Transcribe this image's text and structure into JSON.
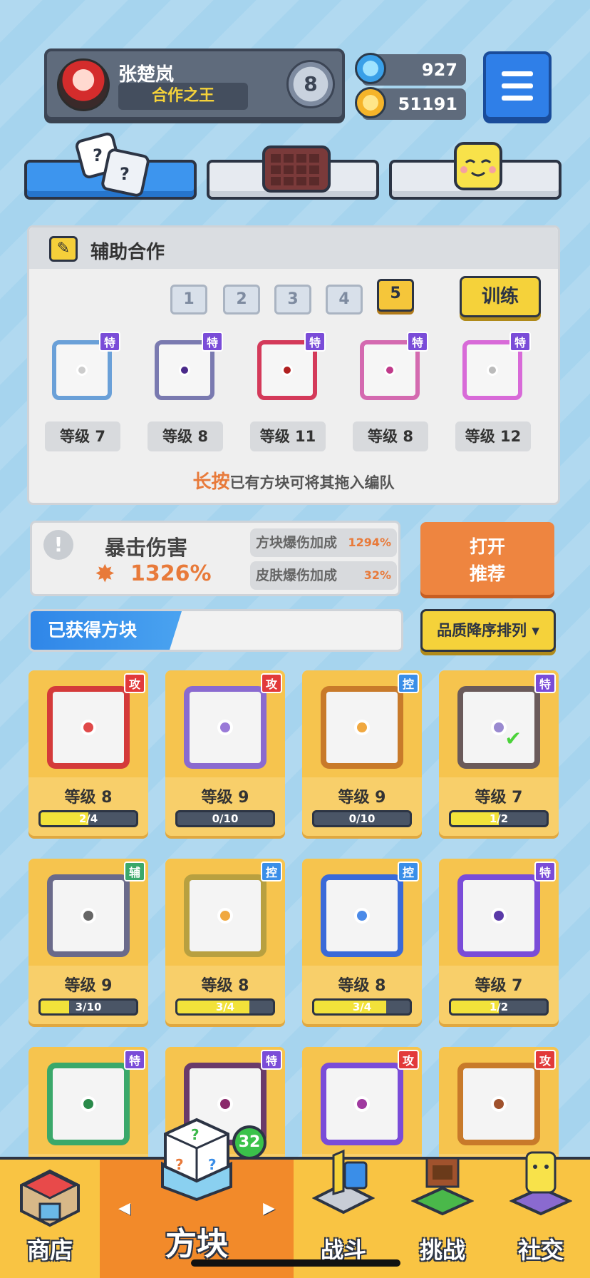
{
  "player": {
    "name": "张楚岚",
    "title": "合作之王",
    "rank": "8"
  },
  "currency": {
    "gems": "927",
    "coins": "51191"
  },
  "tabs": [
    {
      "name": "dice"
    },
    {
      "name": "grid"
    },
    {
      "name": "face"
    }
  ],
  "assist": {
    "title": "辅助合作",
    "pages": [
      "1",
      "2",
      "3",
      "4",
      "5"
    ],
    "active_page": "5",
    "train_label": "训练",
    "slots": [
      {
        "tag": "特",
        "level": "等级 7",
        "color": "#7a4cd8",
        "frame": "#6aa0d8",
        "core": "#cccccc"
      },
      {
        "tag": "特",
        "level": "等级 8",
        "color": "#7a4cd8",
        "frame": "#7a7ab0",
        "core": "#4a2a8a"
      },
      {
        "tag": "特",
        "level": "等级 11",
        "color": "#7a4cd8",
        "frame": "#d43a5a",
        "core": "#b02020"
      },
      {
        "tag": "特",
        "level": "等级 8",
        "color": "#7a4cd8",
        "frame": "#d46ab0",
        "core": "#c03a8a"
      },
      {
        "tag": "特",
        "level": "等级 12",
        "color": "#7a4cd8",
        "frame": "#d86ad8",
        "core": "#bbbbbb"
      }
    ],
    "hint_emph": "长按",
    "hint_rest": "已有方块可将其拖入编队"
  },
  "crit": {
    "title": "暴击伤害",
    "value": "1326%",
    "block_label": "方块爆伤加成",
    "block_value": "1294%",
    "skin_label": "皮肤爆伤加成",
    "skin_value": "32%"
  },
  "open_recommend": {
    "line1": "打开",
    "line2": "推荐"
  },
  "owned": {
    "label": "已获得方块",
    "sort_label": "品质降序排列"
  },
  "tag_colors": {
    "攻": "#e23a3a",
    "控": "#3a8ee8",
    "特": "#7a4cd8",
    "辅": "#3aa86a"
  },
  "cards": [
    {
      "tag": "攻",
      "level": "等级 8",
      "progress": "2/4",
      "ratio": 0.5,
      "frame": "#d43a3a",
      "core": "#e04a4a"
    },
    {
      "tag": "攻",
      "level": "等级 9",
      "progress": "0/10",
      "ratio": 0,
      "frame": "#8a6ad0",
      "core": "#9a7ad8"
    },
    {
      "tag": "控",
      "level": "等级 9",
      "progress": "0/10",
      "ratio": 0,
      "frame": "#c87a2a",
      "core": "#f0a840"
    },
    {
      "tag": "特",
      "level": "等级 7",
      "progress": "1/2",
      "ratio": 0.5,
      "frame": "#6a5a5a",
      "core": "#9a8ad0",
      "equipped": true
    },
    {
      "tag": "辅",
      "level": "等级 9",
      "progress": "3/10",
      "ratio": 0.3,
      "frame": "#6a6a8a",
      "core": "#666666"
    },
    {
      "tag": "控",
      "level": "等级 8",
      "progress": "3/4",
      "ratio": 0.75,
      "frame": "#b8a040",
      "core": "#f0a840"
    },
    {
      "tag": "控",
      "level": "等级 8",
      "progress": "3/4",
      "ratio": 0.75,
      "frame": "#3a6ad8",
      "core": "#4a8ae8"
    },
    {
      "tag": "特",
      "level": "等级 7",
      "progress": "1/2",
      "ratio": 0.5,
      "frame": "#7a4cd8",
      "core": "#5a3aa8"
    },
    {
      "tag": "特",
      "frame": "#3aa86a",
      "core": "#2a8a4a"
    },
    {
      "tag": "特",
      "frame": "#6a3a6a",
      "core": "#8a2a6a"
    },
    {
      "tag": "攻",
      "frame": "#7a4cd8",
      "core": "#a03aa0"
    },
    {
      "tag": "攻",
      "frame": "#c87a2a",
      "core": "#a0522d"
    }
  ],
  "nav": {
    "shop": "商店",
    "blocks": "方块",
    "battle": "战斗",
    "challenge": "挑战",
    "social": "社交",
    "blocks_badge": "32"
  },
  "icons": {
    "menu": "hamburger-icon",
    "gem": "gem-icon",
    "coin": "coin-icon",
    "pencil": "pencil-icon",
    "alert": "exclamation-icon",
    "burst": "burst-icon",
    "sort_arrow": "caret-down-icon"
  }
}
